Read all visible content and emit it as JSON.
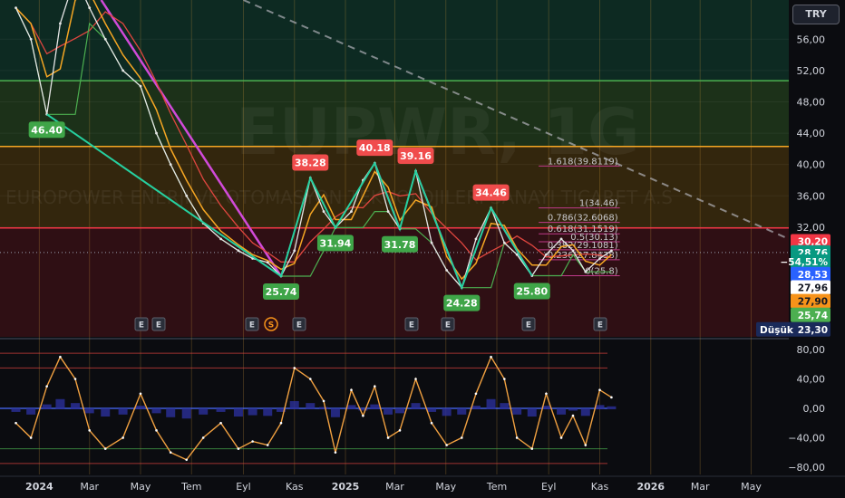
{
  "toolbar": {
    "currency": "TRY"
  },
  "legend_lines": [
    "",
    ""
  ],
  "watermark": "EUPWR, 1G",
  "watermark_sub": "EUROPOWER ENERJI VE OTOMASYON TEKNOLOJILERI SANAYI TICARET A.S",
  "colors": {
    "background": "#0b0c10",
    "fib_line": "#c03a8a",
    "trend_line": "#d14ad9",
    "zigzag": "#26d0a0",
    "price_line": "#e6e6e6",
    "ma_fast": "#f5a623",
    "ma_slow": "#e0463f",
    "ma_green": "#4caf50",
    "osc": "#f0a040",
    "osc_hist": "#2b2f9a",
    "peak_label": "#f04c4c",
    "trough_label": "#3fa548"
  },
  "chart_data": [
    {
      "type": "line",
      "title": "",
      "x": [
        "2023-12-04",
        "2023-12-22",
        "2024-01-10",
        "2024-01-26",
        "2024-02-13",
        "2024-03-01",
        "2024-03-20",
        "2024-04-10",
        "2024-05-01",
        "2024-05-20",
        "2024-06-06",
        "2024-06-25",
        "2024-07-15",
        "2024-08-05",
        "2024-08-26",
        "2024-09-12",
        "2024-09-30",
        "2024-10-16",
        "2024-11-01",
        "2024-11-20",
        "2024-12-06",
        "2024-12-20",
        "2025-01-08",
        "2025-01-22",
        "2025-02-05",
        "2025-02-21",
        "2025-03-07",
        "2025-03-26",
        "2025-04-14",
        "2025-05-02",
        "2025-05-20",
        "2025-06-06",
        "2025-06-24",
        "2025-07-10",
        "2025-07-25",
        "2025-08-12",
        "2025-08-29",
        "2025-09-16",
        "2025-09-30",
        "2025-10-15",
        "2025-11-01",
        "2025-11-15"
      ],
      "series": [
        {
          "name": "",
          "values": [
            60.0,
            56.0,
            46.4,
            58.0,
            64.0,
            60.0,
            56.0,
            52.0,
            50.0,
            44.0,
            40.0,
            36.0,
            32.5,
            30.5,
            29.0,
            28.0,
            27.5,
            25.74,
            29.0,
            38.28,
            34.0,
            31.94,
            34.0,
            38.0,
            40.18,
            34.0,
            31.78,
            39.16,
            30.0,
            26.5,
            24.28,
            30.5,
            34.46,
            30.0,
            28.5,
            25.8,
            28.5,
            30.5,
            29.0,
            26.3,
            28.0,
            29.0
          ]
        }
      ],
      "annotations": [
        {
          "type": "trough",
          "label": "46.40",
          "x": "2024-01-10",
          "y": 46.4
        },
        {
          "type": "trough",
          "label": "25.74",
          "x": "2024-10-16",
          "y": 25.74
        },
        {
          "type": "peak",
          "label": "38.28",
          "x": "2024-11-20",
          "y": 38.28
        },
        {
          "type": "trough",
          "label": "31.94",
          "x": "2024-12-20",
          "y": 31.94
        },
        {
          "type": "peak",
          "label": "40.18",
          "x": "2025-02-05",
          "y": 40.18
        },
        {
          "type": "trough",
          "label": "31.78",
          "x": "2025-03-07",
          "y": 31.78
        },
        {
          "type": "peak",
          "label": "39.16",
          "x": "2025-03-26",
          "y": 39.16
        },
        {
          "type": "trough",
          "label": "24.28",
          "x": "2025-05-20",
          "y": 24.28
        },
        {
          "type": "peak",
          "label": "34.46",
          "x": "2025-06-24",
          "y": 34.46
        },
        {
          "type": "trough",
          "label": "25.80",
          "x": "2025-08-12",
          "y": 25.8
        }
      ],
      "fib_levels": [
        {
          "label": "1.618(39.8119)",
          "value": 39.81
        },
        {
          "label": "1(34.46)",
          "value": 34.46
        },
        {
          "label": "0.786(32.6068)",
          "value": 32.61
        },
        {
          "label": "0.618(31.1519)",
          "value": 31.15
        },
        {
          "label": "0.5(30.13)",
          "value": 30.13
        },
        {
          "label": "0.382(29.1081)",
          "value": 29.11
        },
        {
          "label": "0.236(27.8438)",
          "value": 27.84
        },
        {
          "label": "0(25.8)",
          "value": 25.8
        }
      ],
      "horizontal_levels": [
        50.7,
        42.3,
        31.9
      ],
      "ylim": [
        18,
        61
      ],
      "y_ticks": [
        "56,00",
        "52,00",
        "48,00",
        "44,00",
        "40,00",
        "36,00",
        "32,00"
      ],
      "y_tick_values": [
        56,
        52,
        48,
        44,
        40,
        36,
        32
      ],
      "x_ticks": [
        "2024",
        "Mar",
        "May",
        "Tem",
        "Eyl",
        "Kas",
        "2025",
        "Mar",
        "May",
        "Tem",
        "Eyl",
        "Kas",
        "2026",
        "Mar",
        "May"
      ],
      "price_tags": [
        {
          "text": "30,20",
          "value": 30.2,
          "bg": "#f23645",
          "fg": "#ffffff"
        },
        {
          "text": "28,76",
          "value": 28.76,
          "bg": "#089981",
          "fg": "#ffffff"
        },
        {
          "text": "−54,51%",
          "value": 27.6,
          "bg": "#089981",
          "fg": "#ffffff"
        },
        {
          "text": "28,53",
          "value": 26.0,
          "bg": "#2962ff",
          "fg": "#ffffff"
        },
        {
          "text": "27,96",
          "value": 24.3,
          "bg": "#ffffff",
          "fg": "#131722"
        },
        {
          "text": "27,90",
          "value": 22.55,
          "bg": "#f7931a",
          "fg": "#131722"
        },
        {
          "text": "25,74",
          "value": 20.8,
          "bg": "#4caf50",
          "fg": "#ffffff"
        }
      ],
      "low_label": {
        "caption": "Düşük",
        "value_text": "23,30",
        "value": 18.95
      },
      "earnings_markers": [
        "E",
        "E",
        "E",
        "S",
        "E",
        "E",
        "E",
        "E",
        "E"
      ]
    },
    {
      "type": "line",
      "title": "",
      "x": [
        "2023-12-04",
        "2023-12-22",
        "2024-01-10",
        "2024-01-26",
        "2024-02-13",
        "2024-03-01",
        "2024-03-20",
        "2024-04-10",
        "2024-05-01",
        "2024-05-20",
        "2024-06-06",
        "2024-06-25",
        "2024-07-15",
        "2024-08-05",
        "2024-08-26",
        "2024-09-12",
        "2024-09-30",
        "2024-10-16",
        "2024-11-01",
        "2024-11-20",
        "2024-12-06",
        "2024-12-20",
        "2025-01-08",
        "2025-01-22",
        "2025-02-05",
        "2025-02-21",
        "2025-03-07",
        "2025-03-26",
        "2025-04-14",
        "2025-05-02",
        "2025-05-20",
        "2025-06-06",
        "2025-06-24",
        "2025-07-10",
        "2025-07-25",
        "2025-08-12",
        "2025-08-29",
        "2025-09-16",
        "2025-09-30",
        "2025-10-15",
        "2025-11-01",
        "2025-11-15"
      ],
      "series": [
        {
          "name": "",
          "values": [
            -20,
            -40,
            30,
            70,
            40,
            -30,
            -55,
            -40,
            20,
            -30,
            -60,
            -70,
            -40,
            -20,
            -55,
            -45,
            -50,
            -20,
            55,
            40,
            10,
            -60,
            25,
            -10,
            30,
            -40,
            -30,
            40,
            -20,
            -50,
            -40,
            20,
            70,
            40,
            -40,
            -55,
            20,
            -40,
            -10,
            -50,
            25,
            15
          ]
        }
      ],
      "ylim": [
        -90,
        90
      ],
      "y_ticks": [
        "80,00",
        "40,00",
        "0,00",
        "−40,00",
        "−80,00"
      ],
      "y_tick_values": [
        80,
        40,
        0,
        -40,
        -80
      ],
      "reference_lines": [
        75,
        55,
        -55,
        -75
      ]
    }
  ]
}
